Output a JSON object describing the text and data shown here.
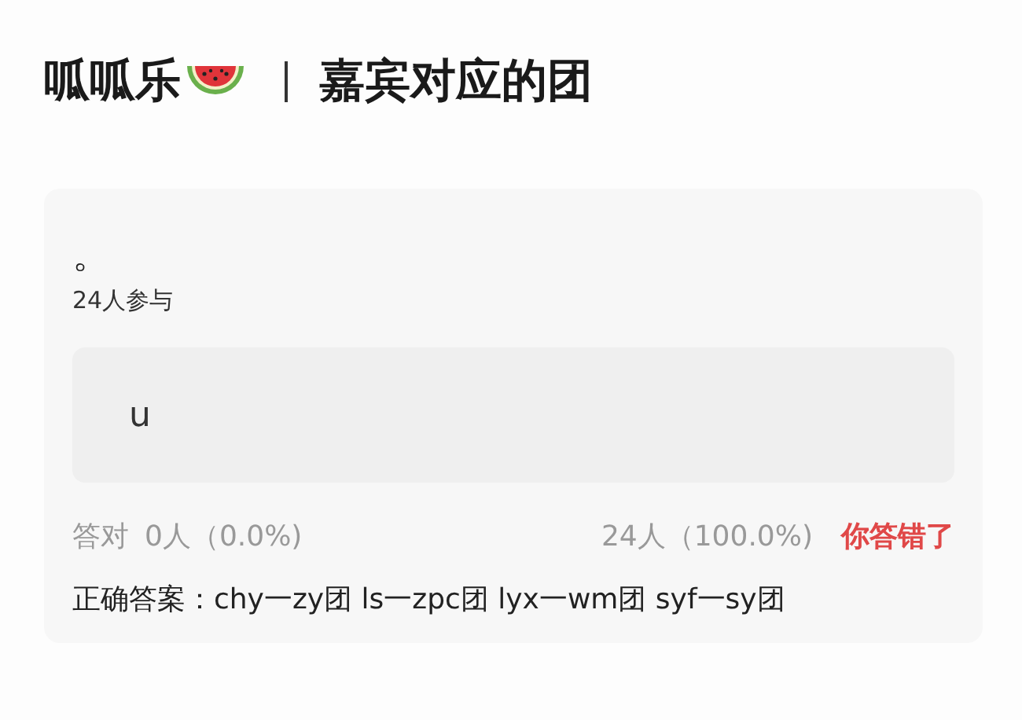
{
  "header": {
    "title": "呱呱乐",
    "subtitle": "嘉宾对应的团"
  },
  "question": {
    "text": "。",
    "participants": "24人参与"
  },
  "options": [
    {
      "text": "u"
    }
  ],
  "result": {
    "correct_label": "答对",
    "correct_count": "0人（0.0%)",
    "other_count": "24人（100.0%)",
    "verdict": "你答错了",
    "is_wrong": true
  },
  "answer": {
    "label": "正确答案：",
    "text": "chy一zy团 ls一zpc团 lyx一wm团 syf一sy团"
  }
}
